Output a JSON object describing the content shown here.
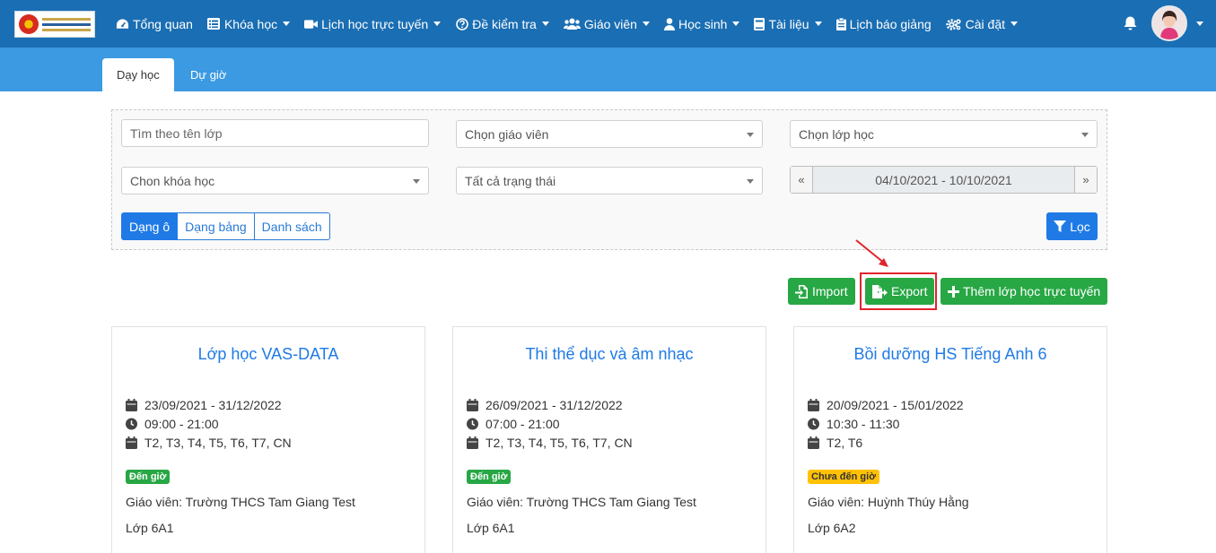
{
  "nav": {
    "items": [
      {
        "label": "Tổng quan",
        "icon": "dashboard-icon",
        "dropdown": false
      },
      {
        "label": "Khóa học",
        "icon": "list-icon",
        "dropdown": true
      },
      {
        "label": "Lịch học trực tuyến",
        "icon": "video-camera-icon",
        "dropdown": true
      },
      {
        "label": "Đề kiểm tra",
        "icon": "question-circle-icon",
        "dropdown": true
      },
      {
        "label": "Giáo viên",
        "icon": "users-icon",
        "dropdown": true
      },
      {
        "label": "Học sinh",
        "icon": "user-icon",
        "dropdown": true
      },
      {
        "label": "Tài liệu",
        "icon": "book-icon",
        "dropdown": true
      },
      {
        "label": "Lịch báo giảng",
        "icon": "clipboard-icon",
        "dropdown": false
      },
      {
        "label": "Cài đặt",
        "icon": "cogs-icon",
        "dropdown": true
      }
    ]
  },
  "tabs": {
    "teaching": "Dạy học",
    "observing": "Dự giờ"
  },
  "filters": {
    "class_search_placeholder": "Tìm theo tên lớp",
    "teacher_select": "Chọn giáo viên",
    "class_select": "Chọn lớp học",
    "course_select": "Chon khóa học",
    "status_select": "Tất cả trạng thái",
    "date_prev": "«",
    "date_range": "04/10/2021 - 10/10/2021",
    "date_next": "»",
    "view_grid": "Dạng ô",
    "view_table": "Dạng bảng",
    "view_list": "Danh sách",
    "filter_button": "Lọc"
  },
  "actions": {
    "import": "Import",
    "export": "Export",
    "add_online_class": "Thêm lớp học trực tuyến"
  },
  "colors": {
    "navbar": "#1a6eb3",
    "subbar": "#3b9ae1",
    "primary": "#1f7ae6",
    "success": "#28a745",
    "warning": "#ffc107",
    "highlight": "#e0242b"
  },
  "cards": [
    {
      "title": "Lớp học VAS-DATA",
      "date_range": "23/09/2021 - 31/12/2022",
      "time": "09:00 - 21:00",
      "days": "T2, T3, T4, T5, T6, T7, CN",
      "status": "Đến giờ",
      "teacher": "Giáo viên: Trường THCS Tam Giang Test",
      "class": "Lớp 6A1"
    },
    {
      "title": "Thi thể dục và âm nhạc",
      "date_range": "26/09/2021 - 31/12/2022",
      "time": "07:00 - 21:00",
      "days": "T2, T3, T4, T5, T6, T7, CN",
      "status": "Đến giờ",
      "teacher": "Giáo viên: Trường THCS Tam Giang Test",
      "class": "Lớp 6A1"
    },
    {
      "title": "Bồi dưỡng HS Tiếng Anh 6",
      "date_range": "20/09/2021 - 15/01/2022",
      "time": "10:30 - 11:30",
      "days": "T2, T6",
      "status": "Chưa đến giờ",
      "teacher": "Giáo viên: Huỳnh Thúy Hằng",
      "class": "Lớp 6A2"
    }
  ]
}
